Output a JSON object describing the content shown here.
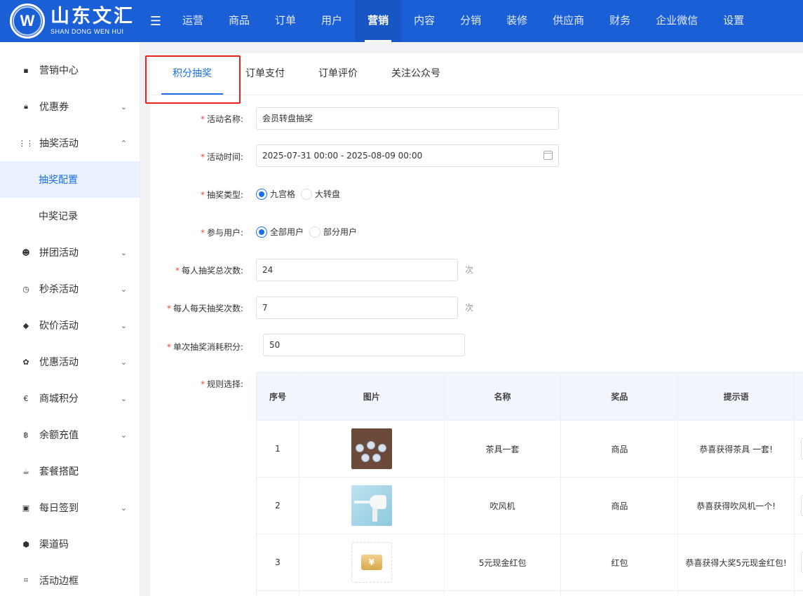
{
  "brand": {
    "name_cn": "山东文汇",
    "name_en": "SHAN DONG WEN HUI",
    "mark": "W"
  },
  "topnav": {
    "items": [
      "运营",
      "商品",
      "订单",
      "用户",
      "营销",
      "内容",
      "分销",
      "装修",
      "供应商",
      "财务",
      "企业微信",
      "设置"
    ],
    "active": "营销"
  },
  "sidebar": {
    "items": [
      {
        "label": "营销中心",
        "icon": "dashboard-icon"
      },
      {
        "label": "优惠券",
        "icon": "lock-icon",
        "arrow": "chevron-down-icon"
      },
      {
        "label": "抽奖活动",
        "icon": "grid-icon",
        "arrow": "chevron-up-icon"
      },
      {
        "label": "拼团活动",
        "icon": "users-icon",
        "arrow": "chevron-down-icon"
      },
      {
        "label": "秒杀活动",
        "icon": "clock-icon",
        "arrow": "chevron-down-icon"
      },
      {
        "label": "砍价活动",
        "icon": "tag-icon",
        "arrow": "chevron-down-icon"
      },
      {
        "label": "优惠活动",
        "icon": "discount-icon",
        "arrow": "chevron-down-icon"
      },
      {
        "label": "商城积分",
        "icon": "euro-icon",
        "arrow": "chevron-down-icon"
      },
      {
        "label": "余额充值",
        "icon": "bitcoin-icon",
        "arrow": "chevron-down-icon"
      },
      {
        "label": "套餐搭配",
        "icon": "cup-icon"
      },
      {
        "label": "每日签到",
        "icon": "calendar-icon",
        "arrow": "chevron-down-icon"
      },
      {
        "label": "渠道码",
        "icon": "cube-icon"
      },
      {
        "label": "活动边框",
        "icon": "crop-icon"
      }
    ],
    "sub_items": [
      {
        "label": "抽奖配置",
        "active": true
      },
      {
        "label": "中奖记录",
        "active": false
      }
    ]
  },
  "tabs": {
    "items": [
      "积分抽奖",
      "订单支付",
      "订单评价",
      "关注公众号"
    ],
    "active": "积分抽奖"
  },
  "form": {
    "required_mark": "*",
    "activity_name": {
      "label": "活动名称:",
      "value": "会员转盘抽奖"
    },
    "activity_time": {
      "label": "活动时间:",
      "value": "2025-07-31 00:00 - 2025-08-09 00:00"
    },
    "lottery_type": {
      "label": "抽奖类型:",
      "options": [
        "九宫格",
        "大转盘"
      ],
      "selected": "九宫格"
    },
    "participants": {
      "label": "参与用户:",
      "options": [
        "全部用户",
        "部分用户"
      ],
      "selected": "全部用户"
    },
    "total_draws": {
      "label": "每人抽奖总次数:",
      "value": "24",
      "unit": "次"
    },
    "daily_draws": {
      "label": "每人每天抽奖次数:",
      "value": "7",
      "unit": "次"
    },
    "points_cost": {
      "label": "单次抽奖消耗积分:",
      "value": "50"
    },
    "rules": {
      "label": "规则选择:"
    }
  },
  "table": {
    "headers": [
      "序号",
      "图片",
      "名称",
      "奖品",
      "提示语"
    ],
    "rows": [
      {
        "no": "1",
        "image": "tea-set-image",
        "name": "茶具一套",
        "prize": "商品",
        "tip": "恭喜获得茶具 一套!"
      },
      {
        "no": "2",
        "image": "hair-dryer-image",
        "name": "吹风机",
        "prize": "商品",
        "tip": "恭喜获得吹风机一个!"
      },
      {
        "no": "3",
        "image": "red-packet-image",
        "name": "5元现金红包",
        "prize": "红包",
        "tip": "恭喜获得大奖5元现金红包!"
      }
    ]
  },
  "colors": {
    "primary": "#1a5fd6",
    "accent": "#1a6fe8",
    "highlight": "#e8231d",
    "required": "#e84a3e"
  }
}
